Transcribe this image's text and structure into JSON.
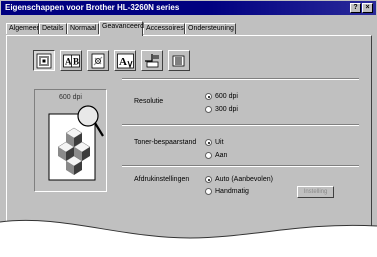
{
  "window": {
    "title": "Eigenschappen voor Brother HL-3260N series",
    "help_button": "?",
    "close_button": "×"
  },
  "tabs": [
    {
      "label": "Algemeen"
    },
    {
      "label": "Details"
    },
    {
      "label": "Normaal"
    },
    {
      "label": "Geavanceerd",
      "active": true
    },
    {
      "label": "Accessoires"
    },
    {
      "label": "Ondersteuning"
    }
  ],
  "toolbar": {
    "icons": [
      {
        "name": "print-quality-icon"
      },
      {
        "name": "ab-icon",
        "text": "A|B"
      },
      {
        "name": "watermark-icon"
      },
      {
        "name": "font-icon",
        "text": "A"
      },
      {
        "name": "device-options-icon"
      },
      {
        "name": "fax-icon"
      }
    ]
  },
  "preview": {
    "dpi_label": "600 dpi"
  },
  "resolutie": {
    "label": "Resolutie",
    "options": [
      {
        "label": "600 dpi",
        "selected": true
      },
      {
        "label": "300 dpi",
        "selected": false
      }
    ]
  },
  "toner": {
    "label": "Toner-bespaarstand",
    "options": [
      {
        "label": "Uit",
        "selected": true
      },
      {
        "label": "Aan",
        "selected": false
      }
    ]
  },
  "afdruk": {
    "label": "Afdrukinstellingen",
    "options": [
      {
        "label": "Auto (Aanbevolen)",
        "selected": true
      },
      {
        "label": "Handmatig",
        "selected": false
      }
    ],
    "button": "Instelling"
  }
}
